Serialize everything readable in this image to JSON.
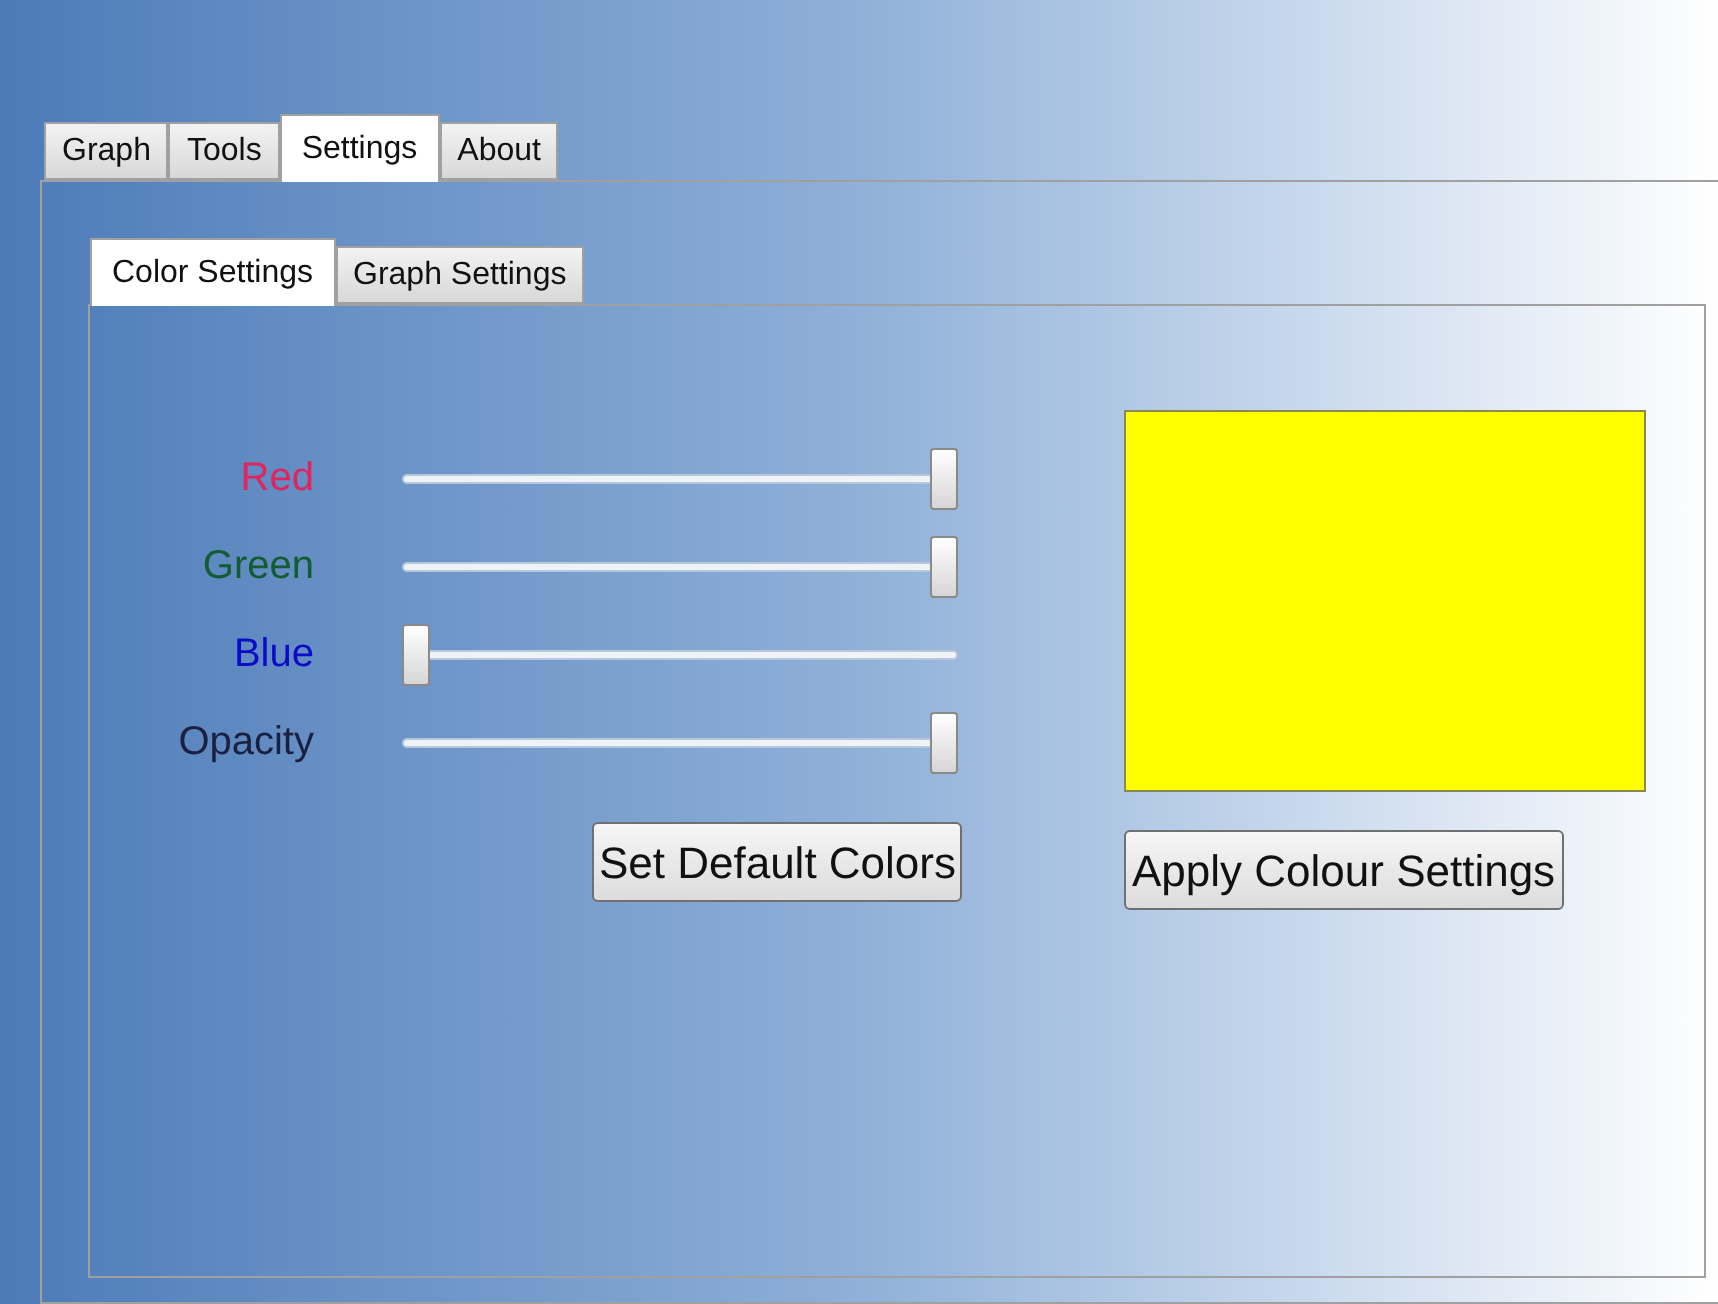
{
  "tabs": [
    {
      "label": "Graph",
      "selected": false
    },
    {
      "label": "Tools",
      "selected": false
    },
    {
      "label": "Settings",
      "selected": true
    },
    {
      "label": "About",
      "selected": false
    }
  ],
  "subtabs": [
    {
      "label": "Color Settings",
      "selected": true
    },
    {
      "label": "Graph Settings",
      "selected": false
    }
  ],
  "sliders": [
    {
      "label": "Red",
      "color": "#e0245e",
      "level": 1
    },
    {
      "label": "Green",
      "color": "#145c32",
      "level": 1
    },
    {
      "label": "Blue",
      "color": "#0c0cc8",
      "level": 0
    },
    {
      "label": "Opacity",
      "color": "#1a2040",
      "level": 1
    }
  ],
  "preview": {
    "color": "#ffff00"
  },
  "buttons": [
    "Set Default Colors",
    "Apply Colour Settings"
  ]
}
